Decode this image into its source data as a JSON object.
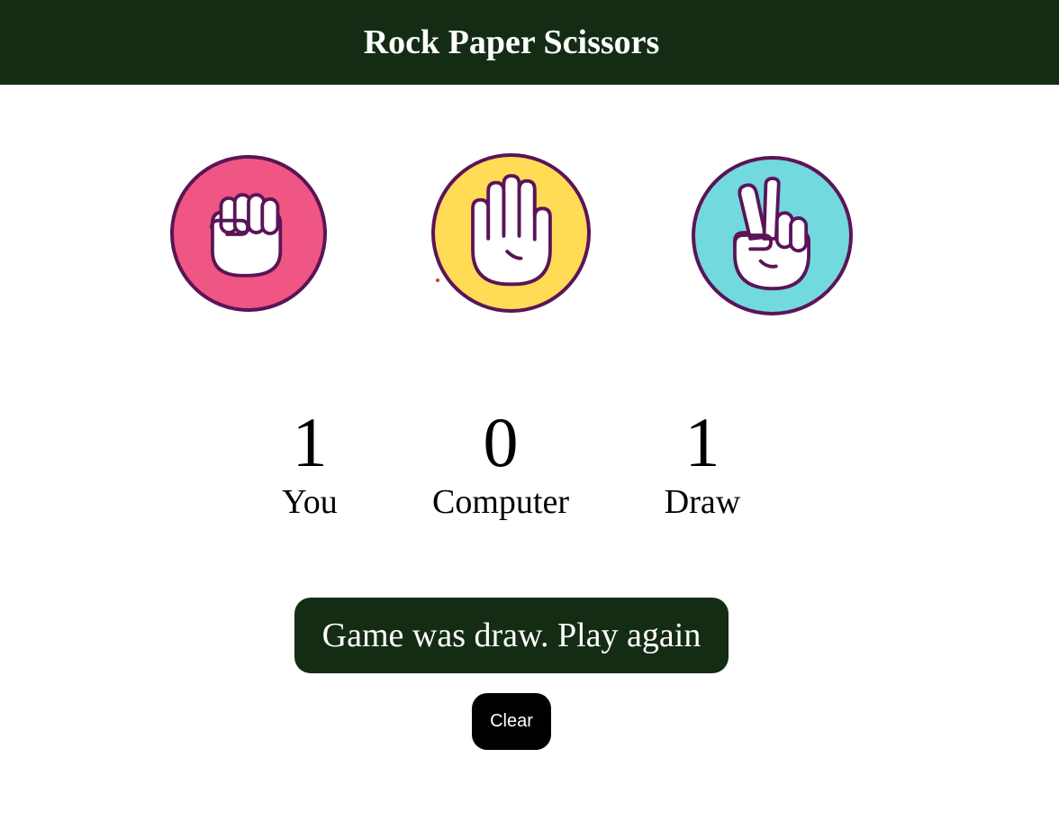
{
  "header": {
    "title": "Rock Paper Scissors"
  },
  "choices": [
    {
      "id": "rock",
      "icon": "fist-icon",
      "color": "#ef5683"
    },
    {
      "id": "paper",
      "icon": "open-hand-icon",
      "color": "#ffdb56"
    },
    {
      "id": "scissors",
      "icon": "peace-hand-icon",
      "color": "#72d9df"
    }
  ],
  "scores": {
    "you": {
      "value": "1",
      "label": "You"
    },
    "computer": {
      "value": "0",
      "label": "Computer"
    },
    "draw": {
      "value": "1",
      "label": "Draw"
    }
  },
  "result": {
    "message": "Game was draw. Play again"
  },
  "clear_button": {
    "label": "Clear"
  },
  "colors": {
    "header_bg": "#142c14",
    "outline": "#5b1457",
    "rock": "#ef5683",
    "paper": "#ffdb56",
    "scissors": "#72d9df"
  }
}
